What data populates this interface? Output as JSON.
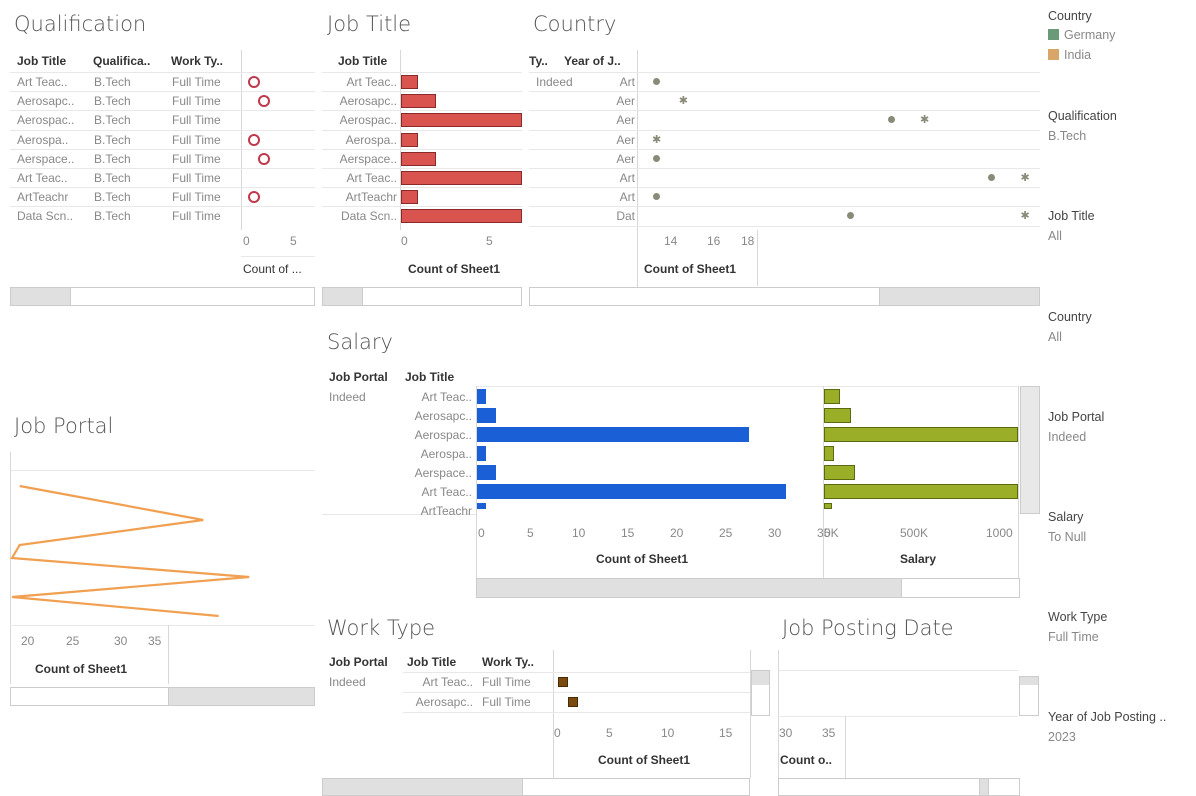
{
  "qualification": {
    "title": "Qualification",
    "headers": [
      "Job Title",
      "Qualifica..",
      "Work Ty.."
    ],
    "rows": [
      [
        "Art Teac..",
        "B.Tech",
        "Full Time"
      ],
      [
        "Aerosapc..",
        "B.Tech",
        "Full Time"
      ],
      [
        "Aerospac..",
        "B.Tech",
        "Full Time"
      ],
      [
        "Aerospa..",
        "B.Tech",
        "Full Time"
      ],
      [
        "Aerspace..",
        "B.Tech",
        "Full Time"
      ],
      [
        "Art Teac..",
        "B.Tech",
        "Full Time"
      ],
      [
        "ArtTeachr",
        "B.Tech",
        "Full Time"
      ],
      [
        "Data Scn..",
        "B.Tech",
        "Full Time"
      ]
    ],
    "ticks": [
      "0",
      "5"
    ],
    "axis_label": "Count of ..."
  },
  "job_title": {
    "title": "Job Title",
    "header": "Job Title",
    "rows": [
      "Art Teac..",
      "Aerosapc..",
      "Aerospac..",
      "Aerospa..",
      "Aerspace..",
      "Art Teac..",
      "ArtTeachr",
      "Data Scn.."
    ],
    "ticks": [
      "0",
      "5"
    ],
    "axis_label": "Count of Sheet1"
  },
  "country": {
    "title": "Country",
    "headers": [
      "Ty..",
      "Year of J.."
    ],
    "portal": "Indeed",
    "rows": [
      "Art",
      "Aer",
      "Aer",
      "Aer",
      "Aer",
      "Art",
      "Art",
      "Dat"
    ],
    "ticks": [
      "14",
      "16",
      "18"
    ],
    "axis_label": "Count of Sheet1"
  },
  "salary": {
    "title": "Salary",
    "headers": [
      "Job Portal",
      "Job Title"
    ],
    "portal": "Indeed",
    "rows": [
      "Art Teac..",
      "Aerosapc..",
      "Aerospac..",
      "Aerospa..",
      "Aerspace..",
      "Art Teac..",
      "ArtTeachr"
    ],
    "count_ticks": [
      "0",
      "5",
      "10",
      "15",
      "20",
      "25",
      "30",
      "35"
    ],
    "count_label": "Count of Sheet1",
    "salary_ticks": [
      "0K",
      "500K",
      "1000"
    ],
    "salary_label": "Salary"
  },
  "job_portal": {
    "title": "Job Portal",
    "ticks": [
      "20",
      "25",
      "30",
      "35"
    ],
    "axis_label": "Count of Sheet1"
  },
  "work_type": {
    "title": "Work Type",
    "headers": [
      "Job Portal",
      "Job Title",
      "Work Ty.."
    ],
    "portal": "Indeed",
    "rows": [
      [
        "Art Teac..",
        "Full Time"
      ],
      [
        "Aerosapc..",
        "Full Time"
      ]
    ],
    "ticks": [
      "0",
      "5",
      "10",
      "15"
    ],
    "axis_label": "Count of Sheet1"
  },
  "job_posting": {
    "title": "Job Posting Date",
    "ticks": [
      "30",
      "35"
    ],
    "axis_label": "Count o.."
  },
  "filters": {
    "legend_title": "Country",
    "legend": [
      {
        "label": "Germany",
        "color": "#6a9a78"
      },
      {
        "label": "India",
        "color": "#d9a66a"
      }
    ],
    "items": [
      {
        "label": "Qualification",
        "value": "B.Tech"
      },
      {
        "label": "Job Title",
        "value": "All"
      },
      {
        "label": "Country",
        "value": "All"
      },
      {
        "label": "Job Portal",
        "value": "Indeed"
      },
      {
        "label": "Salary",
        "value": "To Null"
      },
      {
        "label": "Work Type",
        "value": "Full Time"
      },
      {
        "label": "Year of Job Posting ..",
        "value": "2023"
      }
    ]
  },
  "colors": {
    "jobtitle_bar": "#d9534f",
    "salary_count_bar": "#1a5fd6",
    "salary_value_bar": "#9aae28",
    "portal_line": "#f0a050",
    "worktype_mark": "#7a4a10"
  },
  "chart_data": [
    {
      "type": "bar",
      "title": "Job Title",
      "categories": [
        "Art Teac..",
        "Aerosapc..",
        "Aerospac..",
        "Aerospa..",
        "Aerspace..",
        "Art Teac..",
        "ArtTeachr",
        "Data Scn.."
      ],
      "values": [
        1,
        2,
        7,
        1,
        2,
        7,
        1,
        7
      ],
      "xlabel": "Count of Sheet1",
      "xlim": [
        0,
        7
      ]
    },
    {
      "type": "bar",
      "title": "Salary",
      "categories": [
        "Art Teac..",
        "Aerosapc..",
        "Aerospac..",
        "Aerospa..",
        "Aerspace..",
        "Art Teac..",
        "ArtTeachr"
      ],
      "series": [
        {
          "name": "Count of Sheet1",
          "values": [
            1,
            2,
            29,
            1,
            2,
            33,
            1
          ]
        },
        {
          "name": "Salary",
          "values": [
            80000,
            140000,
            1000000,
            50000,
            160000,
            1000000,
            40000
          ]
        }
      ],
      "xlim_count": [
        0,
        35
      ],
      "xlim_salary": [
        0,
        1000000
      ]
    },
    {
      "type": "scatter",
      "title": "Country",
      "categories": [
        "Art",
        "Aer",
        "Aer",
        "Aer",
        "Aer",
        "Art",
        "Art",
        "Dat"
      ],
      "series": [
        {
          "name": "Germany",
          "values": [
            12.9,
            null,
            16.4,
            null,
            12.9,
            17.9,
            12.9,
            15.8
          ]
        },
        {
          "name": "India",
          "values": [
            null,
            13.3,
            16.9,
            12.9,
            null,
            18.4,
            null,
            18.4
          ]
        }
      ],
      "xlabel": "Count of Sheet1",
      "xlim": [
        12.6,
        18.8
      ]
    },
    {
      "type": "line",
      "title": "Job Portal",
      "x": [
        18,
        30,
        18,
        17.5,
        33,
        17.5,
        31
      ],
      "xlabel": "Count of Sheet1",
      "xlim": [
        17.5,
        36
      ]
    },
    {
      "type": "scatter",
      "title": "Work Type",
      "categories": [
        "Art Teac..",
        "Aerosapc.."
      ],
      "values": [
        1,
        2
      ],
      "xlabel": "Count of Sheet1",
      "xlim": [
        0,
        17
      ]
    }
  ]
}
